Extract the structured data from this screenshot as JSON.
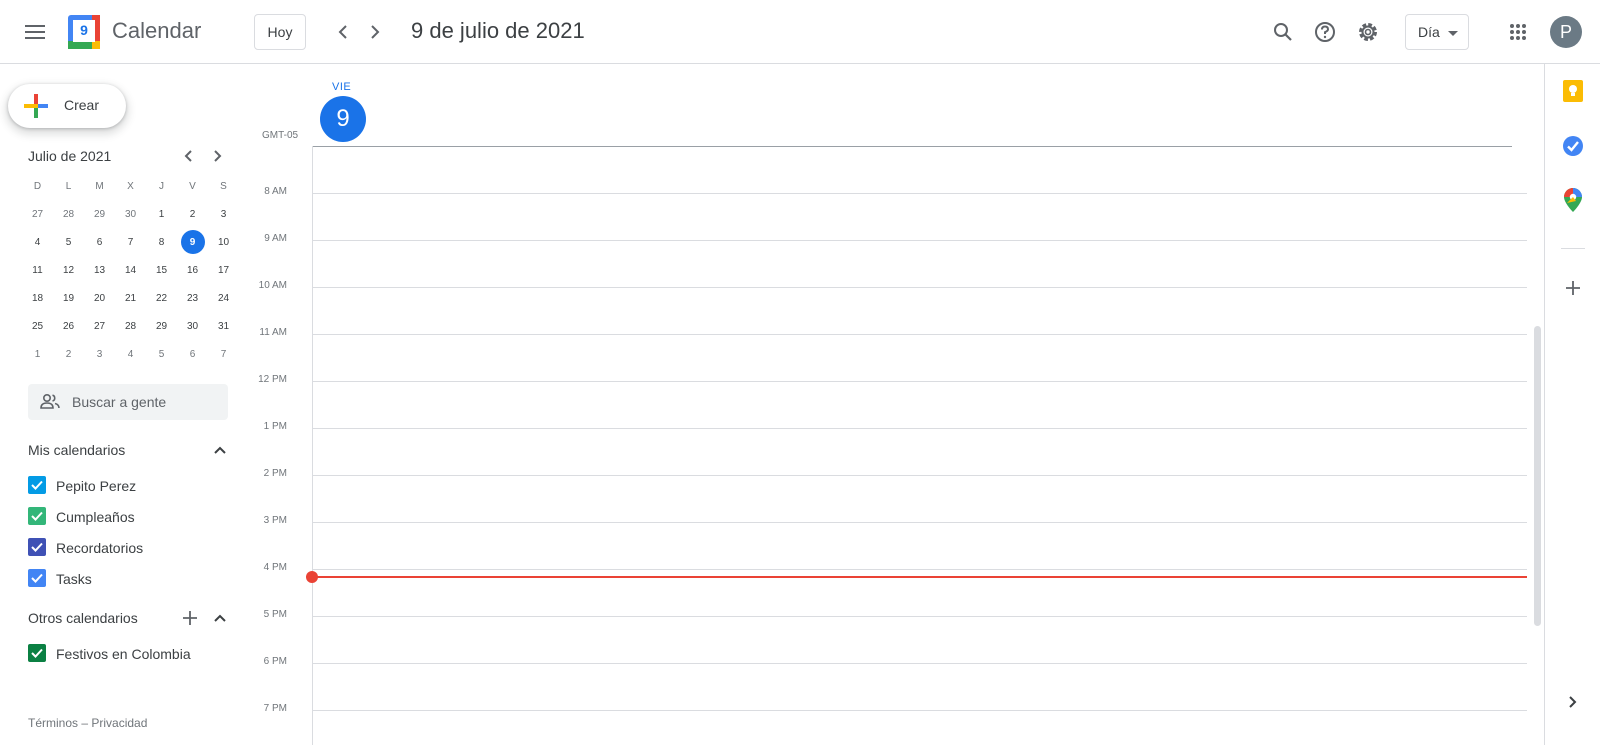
{
  "header": {
    "app_title": "Calendar",
    "logo_day": "9",
    "today_label": "Hoy",
    "date_title": "9 de julio de 2021",
    "view_label": "Día",
    "avatar_initial": "P"
  },
  "sidebar": {
    "create_label": "Crear",
    "mini_calendar": {
      "title": "Julio de 2021",
      "weekdays": [
        "D",
        "L",
        "M",
        "X",
        "J",
        "V",
        "S"
      ],
      "selected_day": "9",
      "weeks": [
        [
          "27",
          "28",
          "29",
          "30",
          "1",
          "2",
          "3"
        ],
        [
          "4",
          "5",
          "6",
          "7",
          "8",
          "9",
          "10"
        ],
        [
          "11",
          "12",
          "13",
          "14",
          "15",
          "16",
          "17"
        ],
        [
          "18",
          "19",
          "20",
          "21",
          "22",
          "23",
          "24"
        ],
        [
          "25",
          "26",
          "27",
          "28",
          "29",
          "30",
          "31"
        ],
        [
          "1",
          "2",
          "3",
          "4",
          "5",
          "6",
          "7"
        ]
      ]
    },
    "people_search_placeholder": "Buscar a gente",
    "my_calendars": {
      "title": "Mis calendarios",
      "items": [
        {
          "name": "Pepito Perez",
          "color": "#039be5"
        },
        {
          "name": "Cumpleaños",
          "color": "#33b679"
        },
        {
          "name": "Recordatorios",
          "color": "#3f51b5"
        },
        {
          "name": "Tasks",
          "color": "#4285f4"
        }
      ]
    },
    "other_calendars": {
      "title": "Otros calendarios",
      "items": [
        {
          "name": "Festivos en Colombia",
          "color": "#0b8043"
        }
      ]
    },
    "footer": "Términos – Privacidad"
  },
  "day_view": {
    "dow": "VIE",
    "day_number": "9",
    "timezone": "GMT-05",
    "hours": [
      "8 AM",
      "9 AM",
      "10 AM",
      "11 AM",
      "12 PM",
      "1 PM",
      "2 PM",
      "3 PM",
      "4 PM",
      "5 PM",
      "6 PM",
      "7 PM"
    ]
  },
  "right_panel": {
    "icons": [
      "keep-icon",
      "tasks-icon",
      "maps-icon",
      "add-icon",
      "expand-icon"
    ]
  }
}
